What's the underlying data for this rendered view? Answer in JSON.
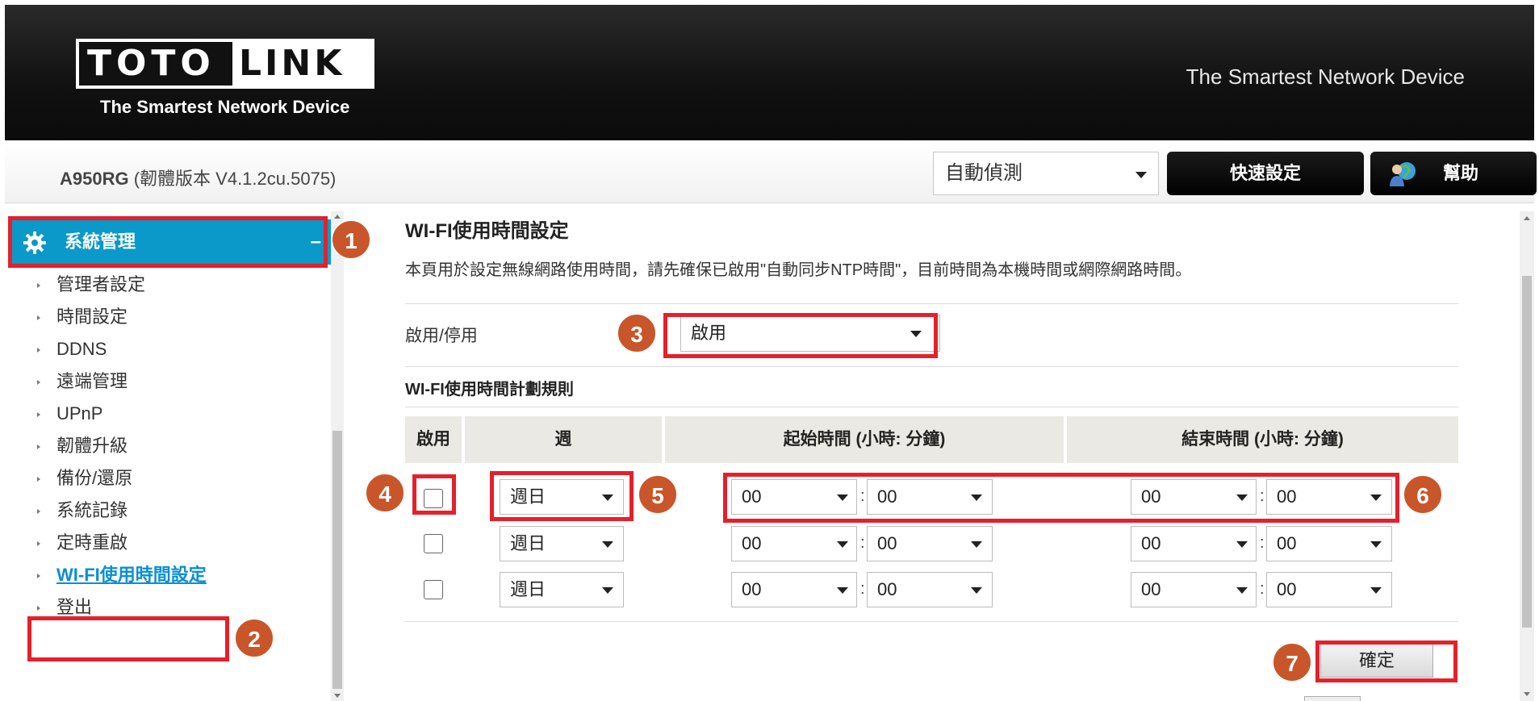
{
  "header": {
    "logo_word1": "TOTO",
    "logo_word2": "LINK",
    "logo_tagline": "The Smartest Network Device",
    "slogan": "The Smartest Network Device"
  },
  "topbar": {
    "model": "A950RG",
    "firmware": "(韌體版本 V4.1.2cu.5075)",
    "language": "自動偵測",
    "quick_setup": "快速設定",
    "help": "幫助"
  },
  "sidebar": {
    "group": "系統管理",
    "collapse": "–",
    "items": [
      {
        "label": "管理者設定"
      },
      {
        "label": "時間設定"
      },
      {
        "label": "DDNS"
      },
      {
        "label": "遠端管理"
      },
      {
        "label": "UPnP"
      },
      {
        "label": "韌體升級"
      },
      {
        "label": "備份/還原"
      },
      {
        "label": "系統記錄"
      },
      {
        "label": "定時重啟"
      },
      {
        "label": "WI-FI使用時間設定"
      },
      {
        "label": "登出"
      }
    ],
    "active_index": 9
  },
  "main": {
    "title": "WI-FI使用時間設定",
    "description": "本頁用於設定無線網路使用時間，請先確保已啟用\"自動同步NTP時間\"，目前時間為本機時間或網際網路時間。",
    "enable_label": "啟用/停用",
    "enable_value": "啟用",
    "rules_title": "WI-FI使用時間計劃規則",
    "columns": {
      "enable": "啟用",
      "week": "週",
      "start": "起始時間 (小時: 分鐘)",
      "end": "結束時間 (小時: 分鐘)"
    },
    "rows": [
      {
        "enabled": false,
        "day": "週日",
        "start_h": "00",
        "start_m": "00",
        "end_h": "00",
        "end_m": "00"
      },
      {
        "enabled": false,
        "day": "週日",
        "start_h": "00",
        "start_m": "00",
        "end_h": "00",
        "end_m": "00"
      },
      {
        "enabled": false,
        "day": "週日",
        "start_h": "00",
        "start_m": "00",
        "end_h": "00",
        "end_m": "00"
      }
    ],
    "colon": ":",
    "confirm": "確定"
  },
  "annotations": [
    "1",
    "2",
    "3",
    "4",
    "5",
    "6",
    "7"
  ],
  "colors": {
    "accent": "#0a99c9",
    "annotation_box": "#e5202b",
    "badge": "#c8562a",
    "header": "#111111"
  }
}
